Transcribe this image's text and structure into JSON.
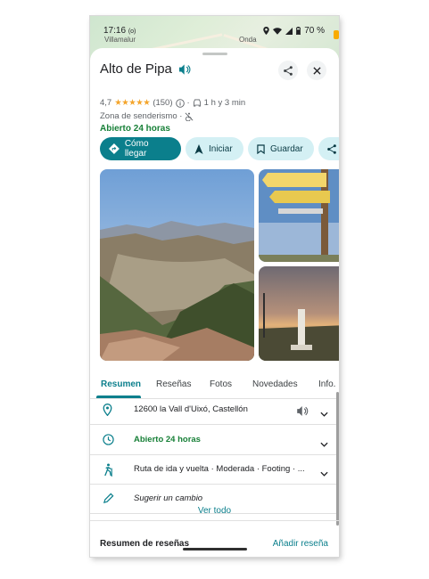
{
  "status_bar": {
    "time": "17:16",
    "indicator": "(o)",
    "battery": "70 %"
  },
  "map": {
    "labels": [
      "Villamalur",
      "Onda"
    ]
  },
  "place": {
    "title": "Alto de Pipa",
    "rating": "4,7",
    "stars": "★★★★★",
    "review_count": "(150)",
    "drive_time": "1 h y 3 min",
    "category": "Zona de senderismo ·",
    "open_status": "Abierto 24 horas"
  },
  "actions": [
    {
      "label": "Cómo llegar",
      "icon": "directions-icon"
    },
    {
      "label": "Iniciar",
      "icon": "navigation-arrow-icon"
    },
    {
      "label": "Guardar",
      "icon": "bookmark-icon"
    },
    {
      "label": "",
      "icon": "share-icon"
    }
  ],
  "tabs": [
    "Resumen",
    "Reseñas",
    "Fotos",
    "Novedades",
    "Info."
  ],
  "info_rows": [
    {
      "icon": "location-pin-icon",
      "text": "12600 la Vall d'Uixó, Castellón"
    },
    {
      "icon": "clock-icon",
      "text": "Abierto 24 horas"
    },
    {
      "icon": "hiking-icon",
      "text": "Ruta de ida y vuelta · Moderada · Footing · ..."
    },
    {
      "icon": "pencil-icon",
      "text": "Sugerir un cambio"
    }
  ],
  "view_all": "Ver todo",
  "reviews_summary": {
    "title": "Resumen de reseñas",
    "add_review": "Añadir reseña"
  },
  "colors": {
    "accent": "#0b7f8c",
    "open_green": "#188038",
    "chip_bg": "#d4f0f4"
  }
}
